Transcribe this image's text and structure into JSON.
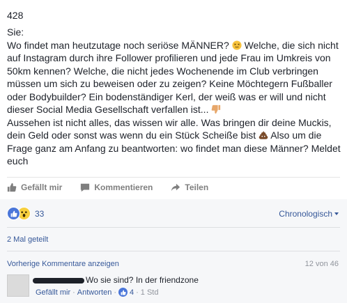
{
  "post": {
    "id_label": "428",
    "body": "Sie:\nWo findet man heutzutage noch seriöse MÄNNER? {emoji1} Welche, die sich nicht auf Instagram durch ihre Follower profilieren und jede Frau im Umkreis von 50km kennen? Welche, die nicht jedes Wochenende im Club verbringen müssen um sich zu beweisen oder zu zeigen? Keine Möchtegern Fußballer oder Bodybuilder? Ein bodenständiger Kerl, der weiß was er will und nicht dieser Social Media Gesellschaft verfallen ist... {emoji2}\nAussehen ist nicht alles, das wissen wir alle. Was bringen dir deine Muckis, dein Geld oder sonst was wenn du ein Stück Scheiße bist {emoji3} Also um die Frage ganz am Anfang zu beantworten: wo findet man diese Männer? Meldet euch",
    "emojis": [
      "confounded-face-emoji",
      "thumbs-down-emoji",
      "pile-of-poo-emoji"
    ]
  },
  "actions": {
    "like_label": "Gefällt mir",
    "comment_label": "Kommentieren",
    "share_label": "Teilen"
  },
  "reactions": {
    "types": [
      "like-icon",
      "wow-icon"
    ],
    "count": "33",
    "order_label": "Chronologisch"
  },
  "shares": {
    "label": "2 Mal geteilt"
  },
  "comments": {
    "prev_label": "Vorherige Kommentare anzeigen",
    "count_label": "12 von 46",
    "items": [
      {
        "text": "Wo sie sind? In der friendzone",
        "like_label": "Gefällt mir",
        "reply_label": "Antworten",
        "likes": "4",
        "time": "1 Std"
      }
    ]
  },
  "colors": {
    "text": "#1d2129",
    "link": "#365899",
    "muted": "#90949c",
    "action_grey": "#7f7f7f",
    "like_blue": "#4a76d9",
    "wow_yellow": "#f7cf3d",
    "panel_bg": "#f6f7f9"
  }
}
